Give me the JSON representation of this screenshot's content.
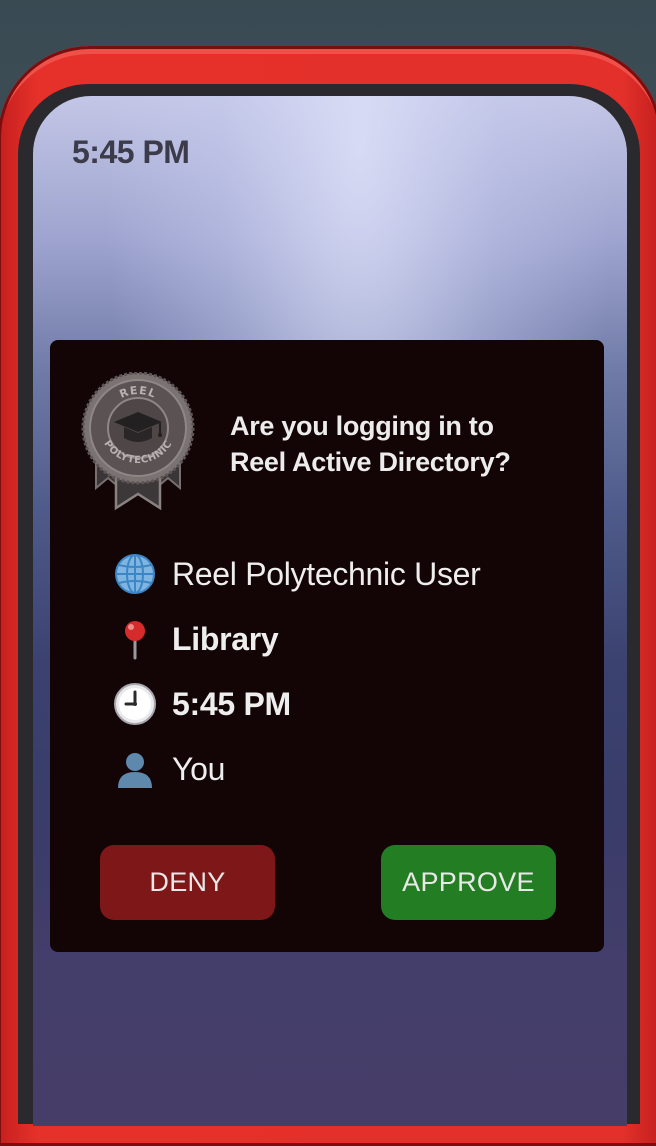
{
  "status_bar": {
    "time": "5:45 PM"
  },
  "prompt": {
    "logo_text_top": "REEL",
    "logo_text_bottom": "POLYTECHNIC",
    "question_line1": "Are you logging in to",
    "question_line2": "Reel Active Directory?"
  },
  "details": [
    {
      "icon": "globe-icon",
      "text": "Reel Polytechnic User"
    },
    {
      "icon": "pushpin-icon",
      "text": "Library"
    },
    {
      "icon": "clock-icon",
      "text": "5:45 PM"
    },
    {
      "icon": "user-silhouette-icon",
      "text": "You"
    }
  ],
  "actions": {
    "deny_label": "DENY",
    "approve_label": "APPROVE"
  },
  "colors": {
    "frame": "#e3302a",
    "card": "#130506",
    "deny": "#7e1717",
    "approve": "#237d22"
  }
}
